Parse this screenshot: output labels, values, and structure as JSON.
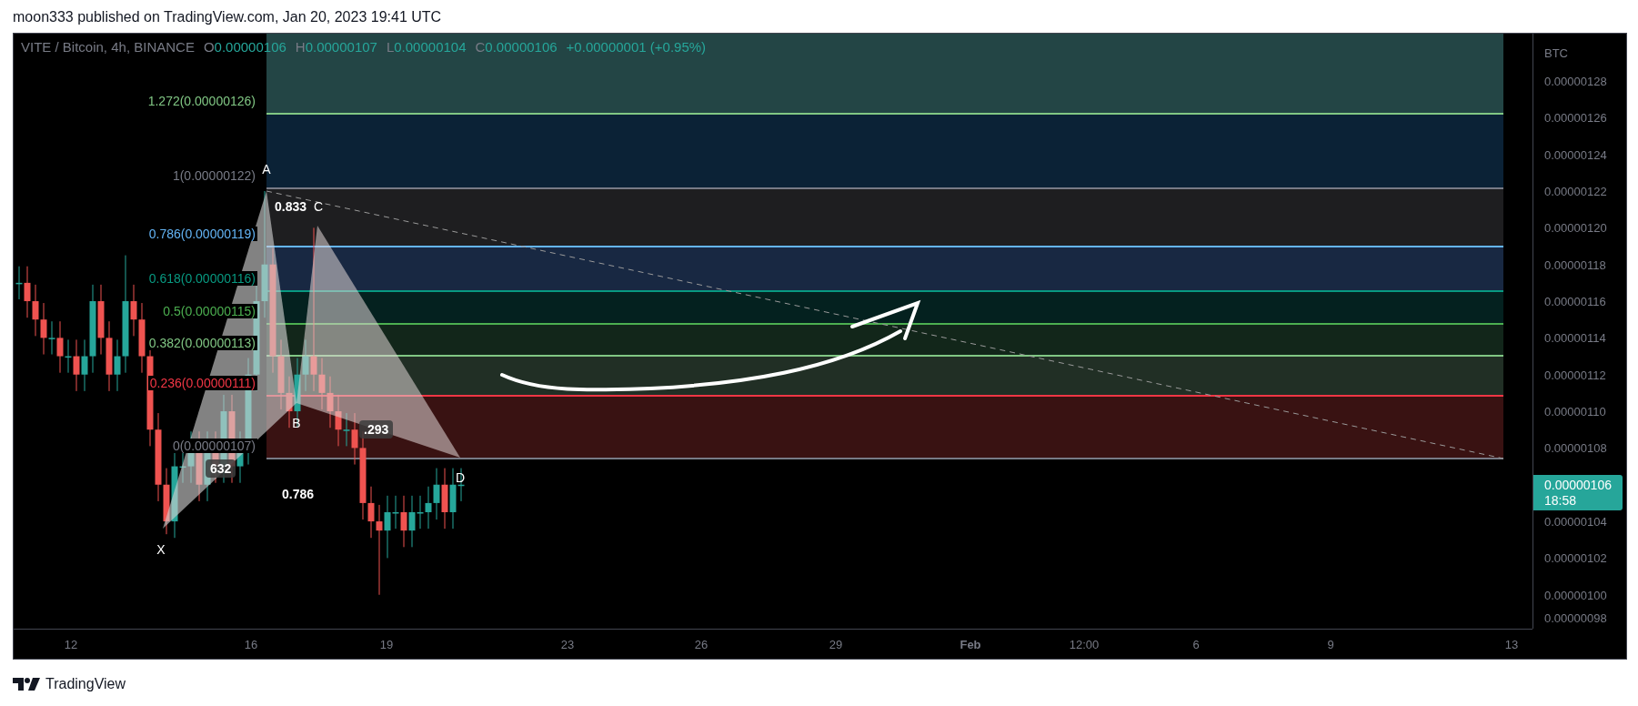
{
  "header": {
    "text": "moon333 published on TradingView.com, Jan 20, 2023 19:41 UTC"
  },
  "legend": {
    "symbol": "VITE / Bitcoin, 4h, BINANCE",
    "ohlc": [
      {
        "key": "O",
        "value": "0.00000106"
      },
      {
        "key": "H",
        "value": "0.00000107"
      },
      {
        "key": "L",
        "value": "0.00000104"
      },
      {
        "key": "C",
        "value": "0.00000106"
      }
    ],
    "change": "+0.00000001 (+0.95%)"
  },
  "fib_levels": [
    {
      "label": "1.272(0.00000126)",
      "color": "#81c784"
    },
    {
      "label": "1(0.00000122)",
      "color": "#787b86"
    },
    {
      "label": "0.786(0.00000119)",
      "color": "#64b5f6"
    },
    {
      "label": "0.618(0.00000116)",
      "color": "#089981"
    },
    {
      "label": "0.5(0.00000115)",
      "color": "#4caf50"
    },
    {
      "label": "0.382(0.00000113)",
      "color": "#81c784"
    },
    {
      "label": "0.236(0.00000111)",
      "color": "#f23645"
    },
    {
      "label": "0(0.00000107)",
      "color": "#787b86"
    }
  ],
  "pattern": {
    "points": [
      {
        "label": "X"
      },
      {
        "label": "A"
      },
      {
        "label": "B"
      },
      {
        "label": "C"
      },
      {
        "label": "D"
      }
    ],
    "ratios": [
      {
        "text": "0.833",
        "kind": "plain"
      },
      {
        "text": "632",
        "kind": "boxed"
      },
      {
        "text": ".293",
        "kind": "boxed"
      },
      {
        "text": "0.786",
        "kind": "plain"
      }
    ]
  },
  "price_axis": {
    "unit": "BTC",
    "ticks": [
      "0.00000128",
      "0.00000126",
      "0.00000124",
      "0.00000122",
      "0.00000120",
      "0.00000118",
      "0.00000116",
      "0.00000114",
      "0.00000112",
      "0.00000110",
      "0.00000108",
      "0.00000104",
      "0.00000102",
      "0.00000100",
      "0.00000098"
    ],
    "current_price": "0.00000106",
    "countdown": "18:58"
  },
  "time_axis": [
    {
      "label": "12",
      "kind": "day"
    },
    {
      "label": "16",
      "kind": "day"
    },
    {
      "label": "19",
      "kind": "day"
    },
    {
      "label": "23",
      "kind": "day"
    },
    {
      "label": "26",
      "kind": "day"
    },
    {
      "label": "29",
      "kind": "day"
    },
    {
      "label": "Feb",
      "kind": "month"
    },
    {
      "label": "12:00",
      "kind": "time"
    },
    {
      "label": "6",
      "kind": "day"
    },
    {
      "label": "9",
      "kind": "day"
    },
    {
      "label": "13",
      "kind": "day"
    }
  ],
  "footer": {
    "brand": "TradingView"
  }
}
